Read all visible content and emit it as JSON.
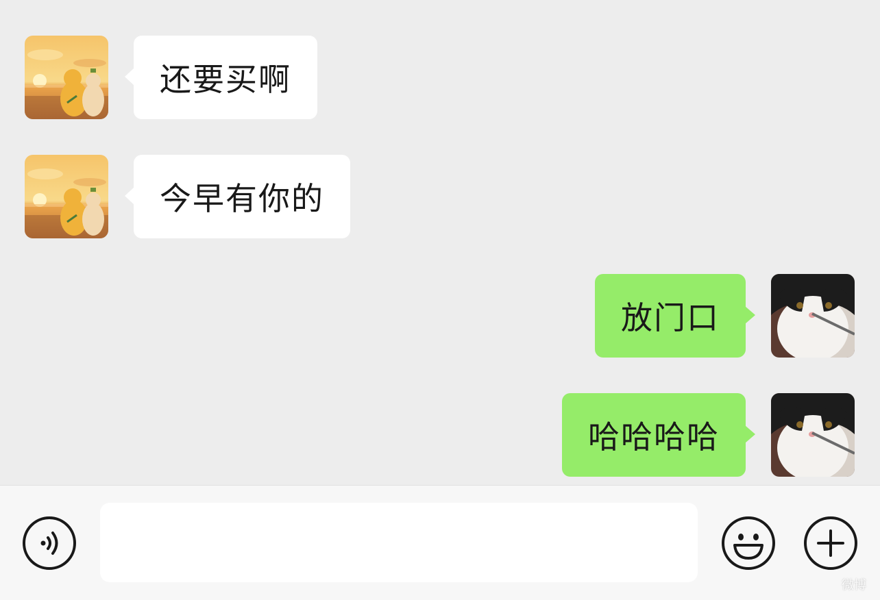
{
  "messages": [
    {
      "direction": "incoming",
      "sender": "contact",
      "avatar": "sunset-ducks-avatar",
      "text": "还要买啊"
    },
    {
      "direction": "incoming",
      "sender": "contact",
      "avatar": "sunset-ducks-avatar",
      "text": "今早有你的"
    },
    {
      "direction": "outgoing",
      "sender": "me",
      "avatar": "cat-avatar",
      "text": "放门口"
    },
    {
      "direction": "outgoing",
      "sender": "me",
      "avatar": "cat-avatar",
      "text": "哈哈哈哈"
    }
  ],
  "input_bar": {
    "voice_icon": "voice-icon",
    "text_value": "",
    "emoji_icon": "emoji-icon",
    "add_icon": "plus-icon"
  },
  "watermark": "微博",
  "colors": {
    "background": "#ededed",
    "incoming_bubble": "#ffffff",
    "outgoing_bubble": "#95ec69",
    "text": "#191919"
  }
}
